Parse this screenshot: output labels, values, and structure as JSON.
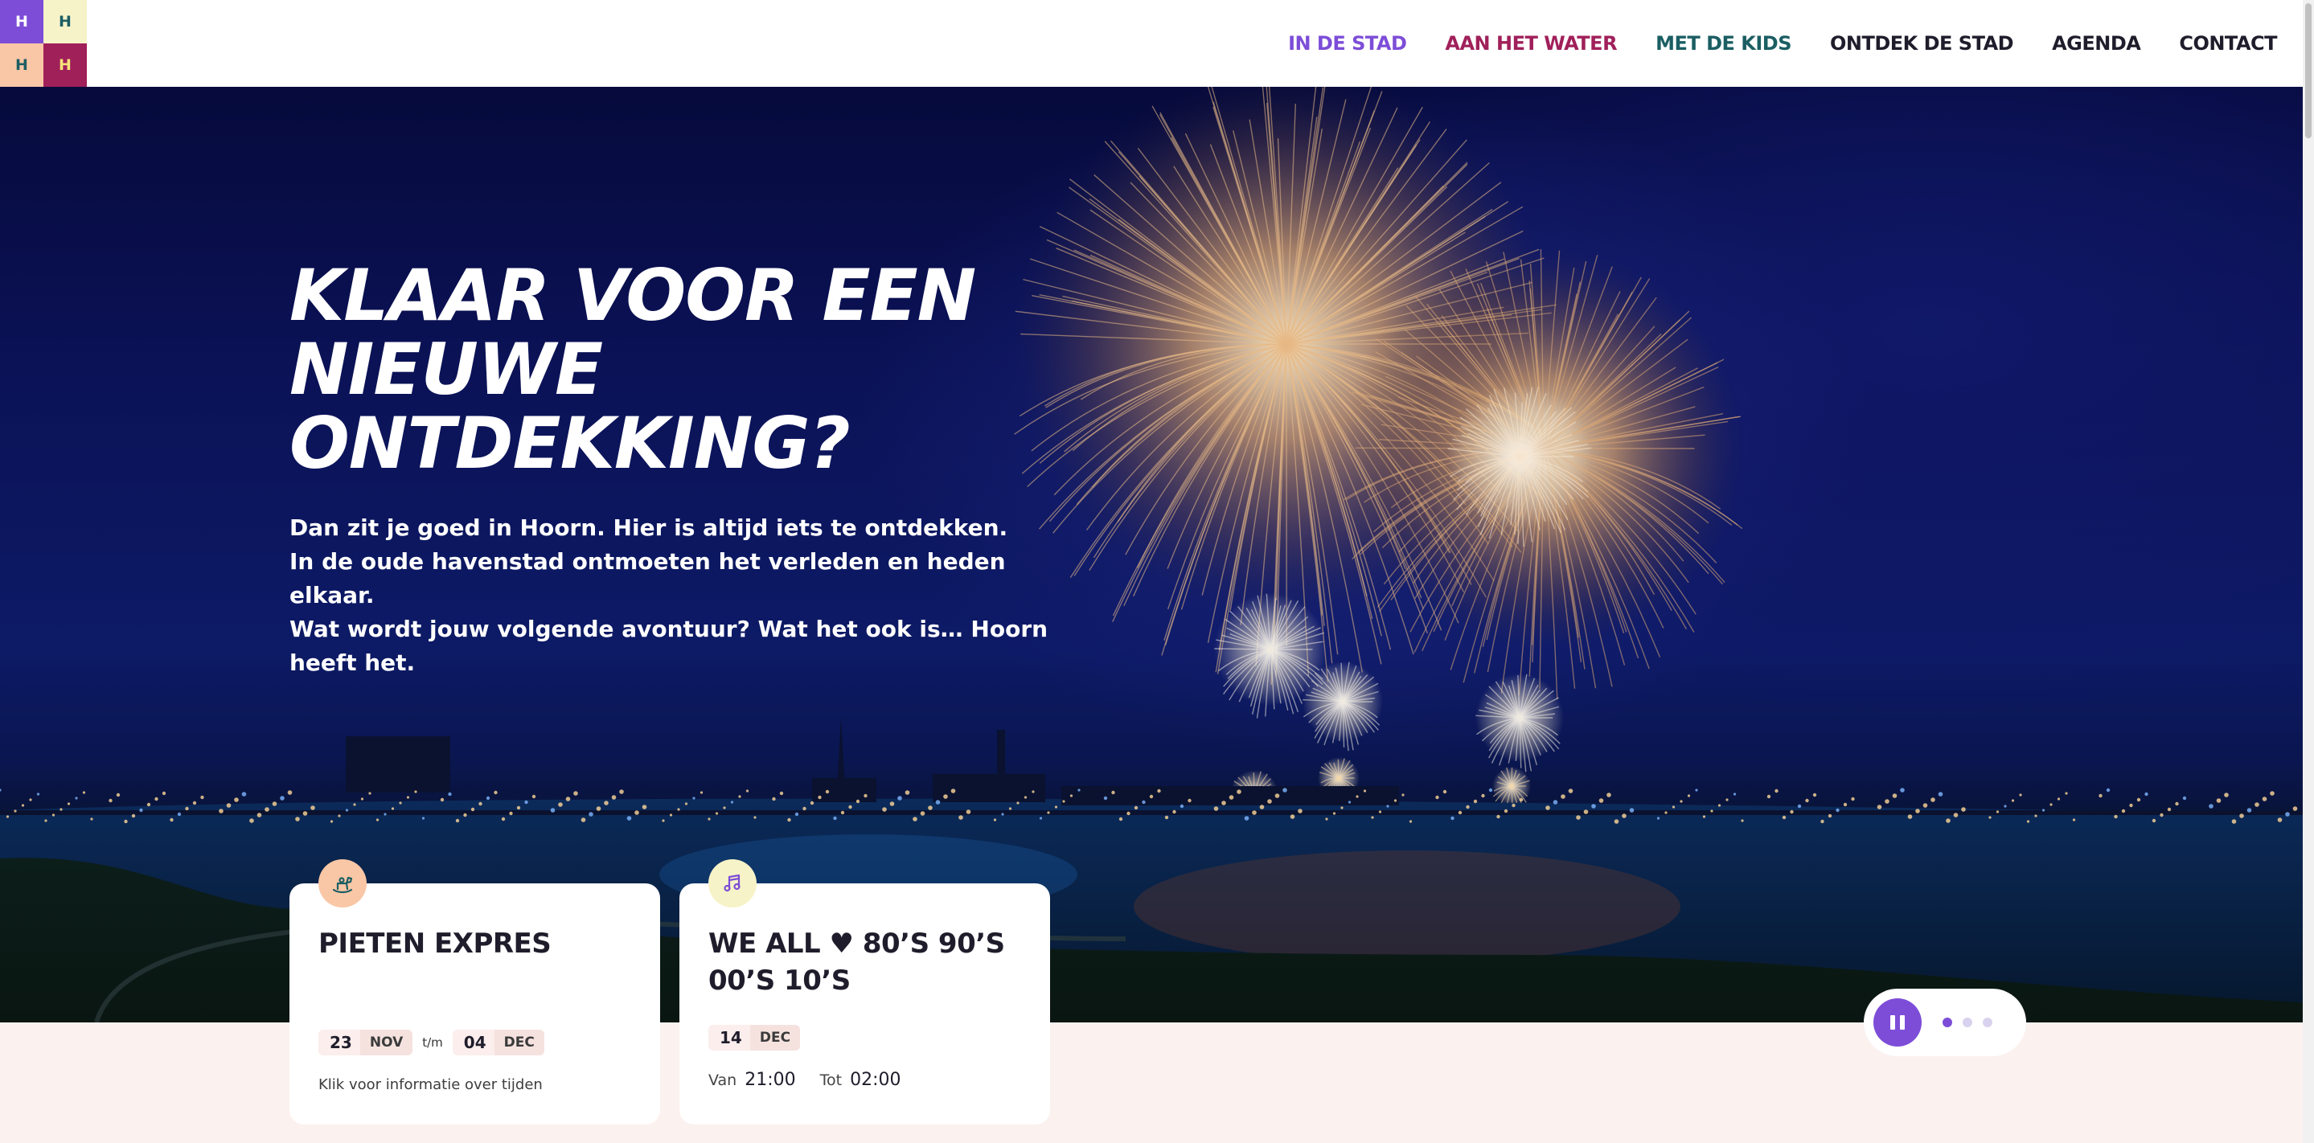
{
  "logo": {
    "tiles": [
      {
        "letter": "H",
        "bg": "#7d4dd8",
        "fg": "#ffffff"
      },
      {
        "letter": "H",
        "bg": "#f7f3c8",
        "fg": "#1b5e63"
      },
      {
        "letter": "H",
        "bg": "#f9c7a6",
        "fg": "#1b5e63"
      },
      {
        "letter": "H",
        "bg": "#a0205a",
        "fg": "#f7e27a"
      }
    ]
  },
  "nav": {
    "items": [
      {
        "label": "IN DE STAD",
        "color": "#7d4dd8"
      },
      {
        "label": "AAN HET WATER",
        "color": "#a0205a"
      },
      {
        "label": "MET DE KIDS",
        "color": "#1b5e63"
      },
      {
        "label": "ONTDEK DE STAD",
        "color": "#1f1d2b"
      },
      {
        "label": "AGENDA",
        "color": "#1f1d2b"
      },
      {
        "label": "CONTACT",
        "color": "#1f1d2b"
      }
    ]
  },
  "hero": {
    "headline_lines": [
      "KLAAR VOOR EEN",
      "NIEUWE",
      "ONTDEKKING?"
    ],
    "intro_lines": [
      "Dan zit je goed in Hoorn. Hier is altijd iets te ontdekken.",
      "In de oude havenstad ontmoeten het verleden en heden elkaar.",
      "Wat wordt jouw volgende avontuur? Wat het ook is… Hoorn heeft het."
    ]
  },
  "cards": [
    {
      "icon": "rocking-horse-icon",
      "icon_bg": "#f9c7a6",
      "title": "PIETEN EXPRES",
      "start_day": "23",
      "start_month": "NOV",
      "range_sep": "t/m",
      "end_day": "04",
      "end_month": "DEC",
      "info": "Klik voor informatie over tijden"
    },
    {
      "icon": "music-note-icon",
      "icon_bg": "#f7f3c8",
      "title": "WE ALL ♥ 80’S 90’S 00’S 10’S",
      "day": "14",
      "month": "DEC",
      "from_label": "Van",
      "from_time": "21:00",
      "to_label": "Tot",
      "to_time": "02:00"
    }
  ],
  "slider": {
    "slides": 3,
    "active": 0,
    "accent": "#7d4dd8"
  }
}
